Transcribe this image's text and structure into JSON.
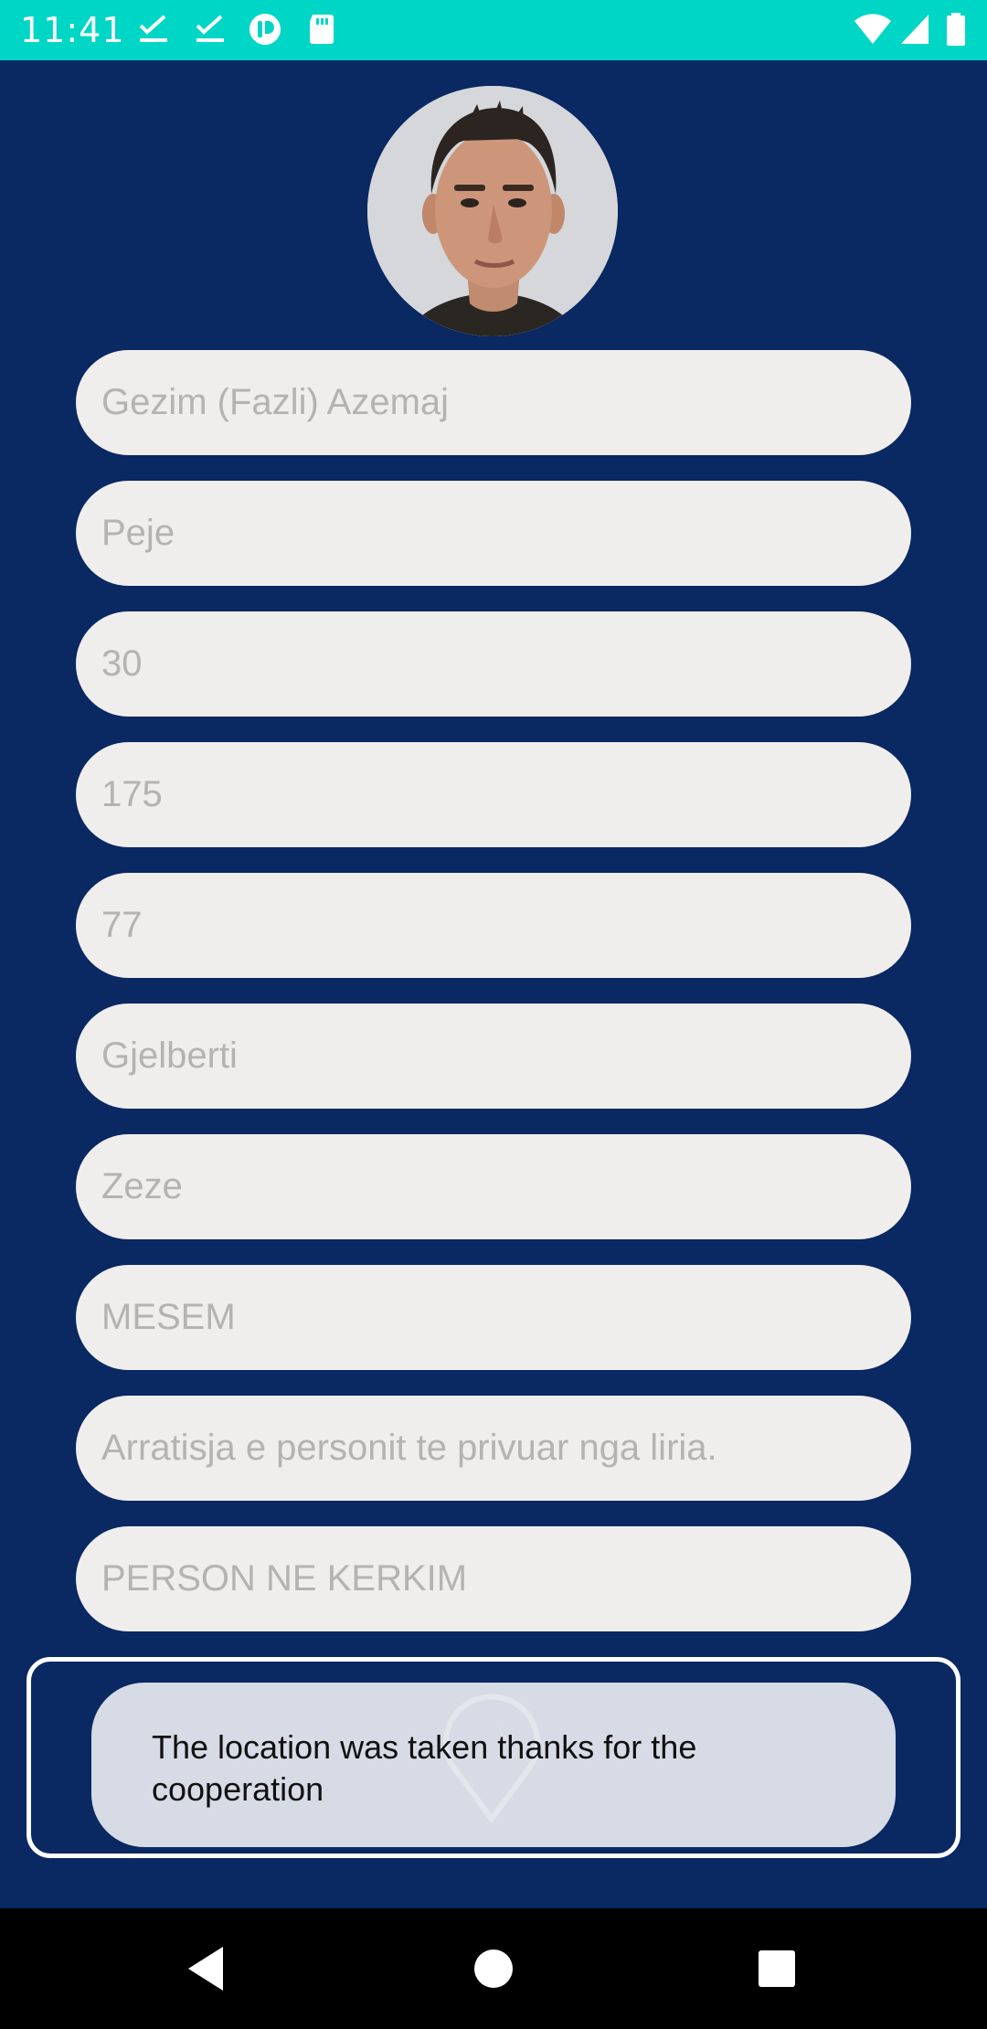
{
  "status_bar": {
    "time": "11:41",
    "color": "#00d6c6",
    "left_icons": [
      "check-icon",
      "check-icon",
      "pocket-icon",
      "sd-card-icon"
    ],
    "right_icons": [
      "wifi-icon",
      "cellular-signal-icon",
      "battery-icon"
    ]
  },
  "profile": {
    "avatar_icon": "person-photo"
  },
  "fields": [
    {
      "value": "Gezim (Fazli) Azemaj"
    },
    {
      "value": "Peje"
    },
    {
      "value": "30"
    },
    {
      "value": "175"
    },
    {
      "value": "77"
    },
    {
      "value": "Gjelberti"
    },
    {
      "value": "Zeze"
    },
    {
      "value": "MESEM"
    },
    {
      "value": "Arratisja e personit te privuar nga liria."
    },
    {
      "value": "PERSON NE KERKIM"
    }
  ],
  "location": {
    "icon": "location-pin-icon"
  },
  "toast": {
    "message": "The location was taken thanks for the cooperation"
  },
  "nav_bar": {
    "back_icon": "back-triangle-icon",
    "home_icon": "home-circle-icon",
    "recents_icon": "recents-square-icon"
  },
  "colors": {
    "background": "#0a2861",
    "field_background": "#f0eeed",
    "field_text": "#b5b3b2",
    "toast_background": "#e2e5ec"
  }
}
